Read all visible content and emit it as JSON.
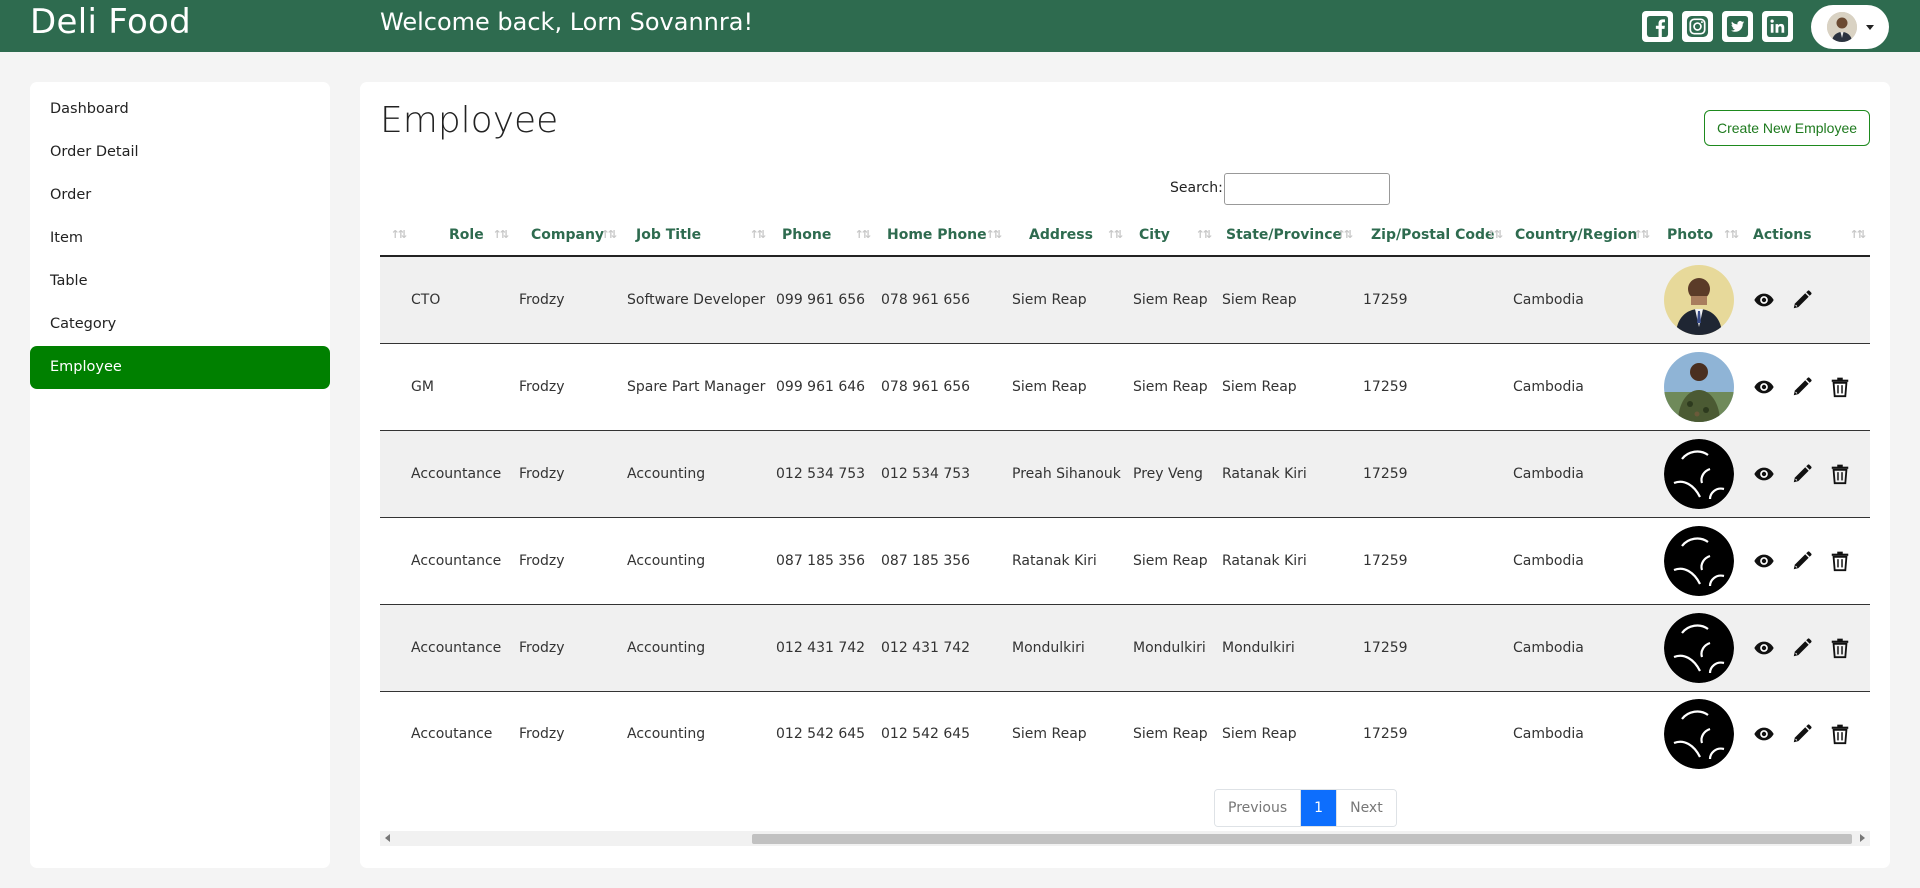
{
  "header": {
    "brand": "Deli Food",
    "welcome": "Welcome back, Lorn Sovannra!",
    "social_icons": [
      "facebook-icon",
      "instagram-icon",
      "twitter-icon",
      "linkedin-icon"
    ]
  },
  "sidebar": {
    "items": [
      {
        "label": "Dashboard",
        "active": false
      },
      {
        "label": "Order Detail",
        "active": false
      },
      {
        "label": "Order",
        "active": false
      },
      {
        "label": "Item",
        "active": false
      },
      {
        "label": "Table",
        "active": false
      },
      {
        "label": "Category",
        "active": false
      },
      {
        "label": "Employee",
        "active": true
      }
    ]
  },
  "main": {
    "title": "Employee",
    "create_button": "Create New Employee",
    "search_label": "Search:",
    "search_value": "",
    "columns": [
      "",
      "Role",
      "Company",
      "Job Title",
      "Phone",
      "Home Phone",
      "Address",
      "City",
      "State/Province",
      "Zip/Postal Code",
      "Country/Region",
      "Photo",
      "Actions"
    ],
    "rows": [
      {
        "role": "CTO",
        "company": "Frodzy",
        "job_title": "Software Developer",
        "phone": "099 961 656",
        "home_phone": "078 961 656",
        "address": "Siem Reap",
        "city": "Siem Reap",
        "state": "Siem Reap",
        "zip": "17259",
        "country": "Cambodia",
        "photo": "person-suit-photo",
        "delete": false
      },
      {
        "role": "GM",
        "company": "Frodzy",
        "job_title": "Spare Part Manager",
        "phone": "099 961 646",
        "home_phone": "078 961 656",
        "address": "Siem Reap",
        "city": "Siem Reap",
        "state": "Siem Reap",
        "zip": "17259",
        "country": "Cambodia",
        "photo": "person-outdoor-photo",
        "delete": true
      },
      {
        "role": "Accountance",
        "company": "Frodzy",
        "job_title": "Accounting",
        "phone": "012 534 753",
        "home_phone": "012 534 753",
        "address": "Preah Sihanouk",
        "city": "Prey Veng",
        "state": "Ratanak Kiri",
        "zip": "17259",
        "country": "Cambodia",
        "photo": "default-user-icon",
        "delete": true
      },
      {
        "role": "Accountance",
        "company": "Frodzy",
        "job_title": "Accounting",
        "phone": "087 185 356",
        "home_phone": "087 185 356",
        "address": "Ratanak Kiri",
        "city": "Siem Reap",
        "state": "Ratanak Kiri",
        "zip": "17259",
        "country": "Cambodia",
        "photo": "default-user-icon",
        "delete": true
      },
      {
        "role": "Accountance",
        "company": "Frodzy",
        "job_title": "Accounting",
        "phone": "012 431 742",
        "home_phone": "012 431 742",
        "address": "Mondulkiri",
        "city": "Mondulkiri",
        "state": "Mondulkiri",
        "zip": "17259",
        "country": "Cambodia",
        "photo": "default-user-icon",
        "delete": true
      },
      {
        "role": "Accoutance",
        "company": "Frodzy",
        "job_title": "Accounting",
        "phone": "012 542 645",
        "home_phone": "012 542 645",
        "address": "Siem Reap",
        "city": "Siem Reap",
        "state": "Siem Reap",
        "zip": "17259",
        "country": "Cambodia",
        "photo": "default-user-icon",
        "delete": true
      }
    ],
    "pagination": {
      "previous": "Previous",
      "current": "1",
      "next": "Next"
    }
  },
  "colors": {
    "header_bg": "#2e6b4f",
    "sidebar_active": "#008000",
    "column_header_text": "#2e6b4f",
    "create_button_border": "#1e8a1e",
    "pagination_active": "#0d6efd"
  }
}
